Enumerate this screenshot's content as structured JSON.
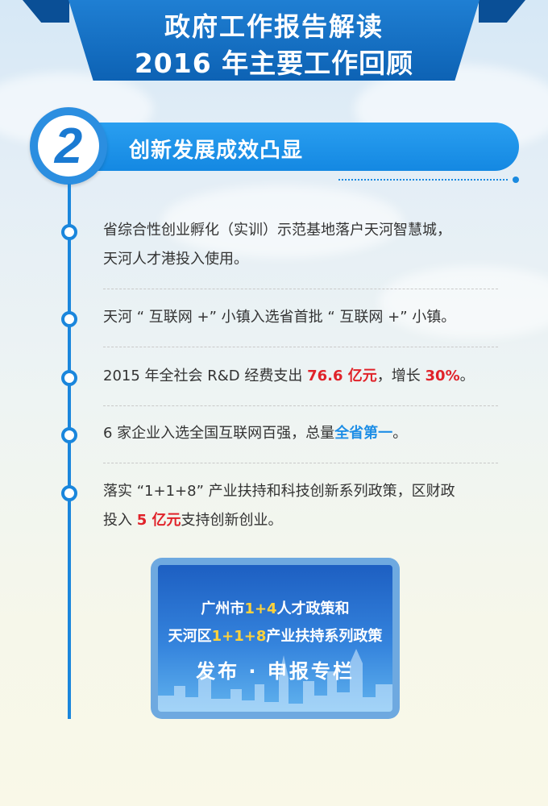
{
  "header": {
    "line1": "政府工作报告解读",
    "line2": "2016 年主要工作回顾"
  },
  "section": {
    "number": "2",
    "title": "创新发展成效凸显"
  },
  "items": [
    {
      "line1": "省综合性创业孵化（实训）示范基地落户天河智慧城，",
      "line2": "天河人才港投入使用。"
    },
    {
      "text": "天河 “ 互联网 +” 小镇入选省首批 “ 互联网 +” 小镇。"
    },
    {
      "pre": "2015 年全社会 R&D 经费支出 ",
      "highlight1": "76.6 亿元",
      "mid": "，增长 ",
      "highlight2": "30%",
      "post": "。"
    },
    {
      "pre": "6 家企业入选全国互联网百强，总量",
      "highlight": "全省第一",
      "post": "。"
    },
    {
      "line1": "落实 “1+1+8” 产业扶持和科技创新系列政策，区财政",
      "line2_pre": "投入 ",
      "line2_highlight": "5 亿元",
      "line2_post": "支持创新创业。"
    }
  ],
  "promo": {
    "line1_pre": "广州市",
    "line1_highlight": "1+4",
    "line1_post": "人才政策和",
    "line2_pre": "天河区",
    "line2_highlight": "1+1+8",
    "line2_post": "产业扶持系列政策",
    "line3": "发布 · 申报专栏"
  },
  "colors": {
    "primary_blue": "#1a86dc",
    "highlight_red": "#e0232a",
    "highlight_blue": "#1e8ee6",
    "highlight_yellow": "#ffd23a"
  }
}
